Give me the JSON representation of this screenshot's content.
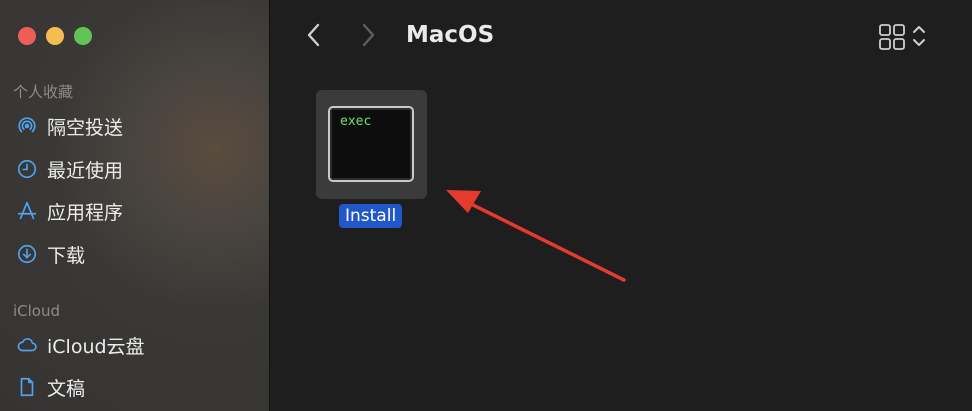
{
  "sidebar": {
    "favorites_title": "个人收藏",
    "favorites": [
      {
        "label": "隔空投送",
        "icon": "airdrop-icon"
      },
      {
        "label": "最近使用",
        "icon": "clock-icon"
      },
      {
        "label": "应用程序",
        "icon": "applications-icon"
      },
      {
        "label": "下载",
        "icon": "download-icon"
      }
    ],
    "icloud_title": "iCloud",
    "icloud_items": [
      {
        "label": "iCloud云盘",
        "icon": "cloud-icon"
      },
      {
        "label": "文稿",
        "icon": "document-icon"
      }
    ]
  },
  "toolbar": {
    "title": "MacOS"
  },
  "files": [
    {
      "name": "Install",
      "preview_text": "exec",
      "selected": true
    }
  ],
  "colors": {
    "accent": "#2157c8",
    "annotation_arrow": "#e53a2e",
    "terminal_text": "#6fe06f"
  }
}
